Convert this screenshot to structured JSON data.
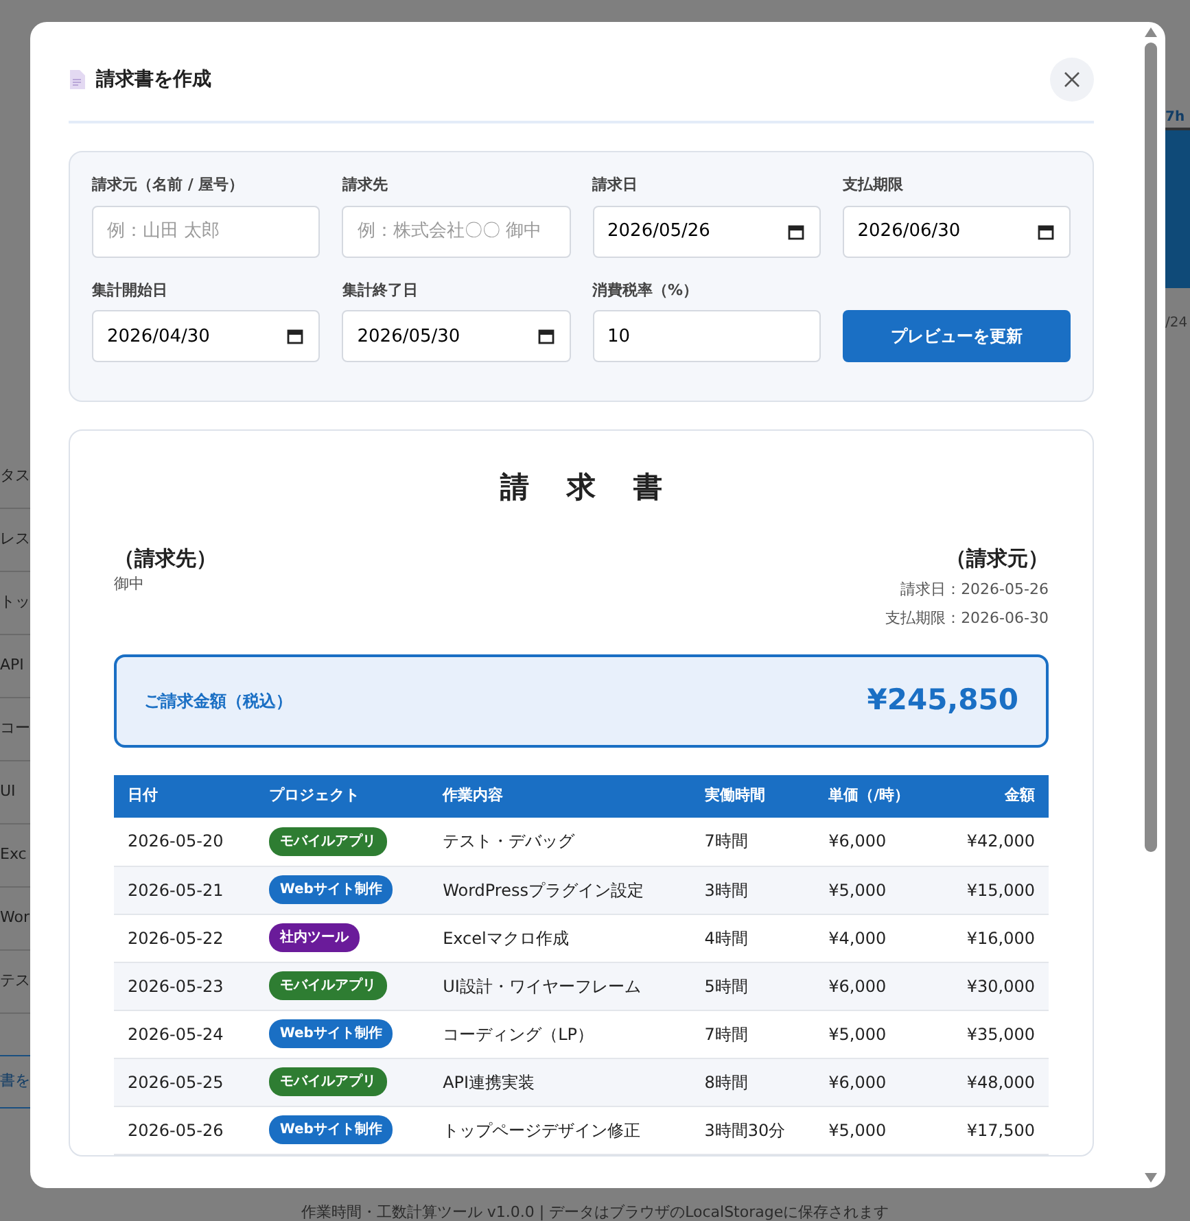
{
  "background": {
    "left_items": [
      "タス",
      "レス",
      "トッ",
      "API",
      "コー",
      "UI",
      "Exc",
      "Wor",
      "テス"
    ],
    "left_button": "書を",
    "right_header": "7h",
    "right_text": "/24",
    "footer": "作業時間・工数計算ツール v1.0.0 | データはブラウザのLocalStorageに保存されます"
  },
  "modal": {
    "title": "請求書を作成"
  },
  "form": {
    "fields": [
      {
        "kind": "text",
        "label": "請求元（名前 / 屋号）",
        "placeholder": "例：山田 太郎"
      },
      {
        "kind": "text",
        "label": "請求先",
        "placeholder": "例：株式会社〇〇 御中"
      },
      {
        "kind": "date",
        "label": "請求日",
        "value": "2026/05/26"
      },
      {
        "kind": "date",
        "label": "支払期限",
        "value": "2026/06/30"
      },
      {
        "kind": "date",
        "label": "集計開始日",
        "value": "2026/04/30"
      },
      {
        "kind": "date",
        "label": "集計終了日",
        "value": "2026/05/30"
      },
      {
        "kind": "text",
        "label": "消費税率（%）",
        "value": "10"
      }
    ],
    "button": "プレビューを更新"
  },
  "invoice": {
    "title": "請求書",
    "to_heading": "（請求先）",
    "to_name": "御中",
    "from_heading": "（請求元）",
    "issue_date": "請求日：2026-05-26",
    "due_date": "支払期限：2026-06-30",
    "total_label": "ご請求金額（税込）",
    "total": "¥245,850"
  },
  "table": {
    "columns": [
      "日付",
      "プロジェクト",
      "作業内容",
      "実働時間",
      "単価（/時）",
      "金額"
    ],
    "rows": [
      {
        "date": "2026-05-20",
        "project": {
          "label": "モバイルアプリ",
          "color": "#2e7d32"
        },
        "task": "テスト・デバッグ",
        "hours": "7時間",
        "rate": "¥6,000",
        "amount": "¥42,000"
      },
      {
        "date": "2026-05-21",
        "project": {
          "label": "Webサイト制作",
          "color": "#1a6fc4"
        },
        "task": "WordPressプラグイン設定",
        "hours": "3時間",
        "rate": "¥5,000",
        "amount": "¥15,000"
      },
      {
        "date": "2026-05-22",
        "project": {
          "label": "社内ツール",
          "color": "#6a1b9a"
        },
        "task": "Excelマクロ作成",
        "hours": "4時間",
        "rate": "¥4,000",
        "amount": "¥16,000"
      },
      {
        "date": "2026-05-23",
        "project": {
          "label": "モバイルアプリ",
          "color": "#2e7d32"
        },
        "task": "UI設計・ワイヤーフレーム",
        "hours": "5時間",
        "rate": "¥6,000",
        "amount": "¥30,000"
      },
      {
        "date": "2026-05-24",
        "project": {
          "label": "Webサイト制作",
          "color": "#1a6fc4"
        },
        "task": "コーディング（LP）",
        "hours": "7時間",
        "rate": "¥5,000",
        "amount": "¥35,000"
      },
      {
        "date": "2026-05-25",
        "project": {
          "label": "モバイルアプリ",
          "color": "#2e7d32"
        },
        "task": "API連携実装",
        "hours": "8時間",
        "rate": "¥6,000",
        "amount": "¥48,000"
      },
      {
        "date": "2026-05-26",
        "project": {
          "label": "Webサイト制作",
          "color": "#1a6fc4"
        },
        "task": "トップページデザイン修正",
        "hours": "3時間30分",
        "rate": "¥5,000",
        "amount": "¥17,500"
      }
    ]
  }
}
